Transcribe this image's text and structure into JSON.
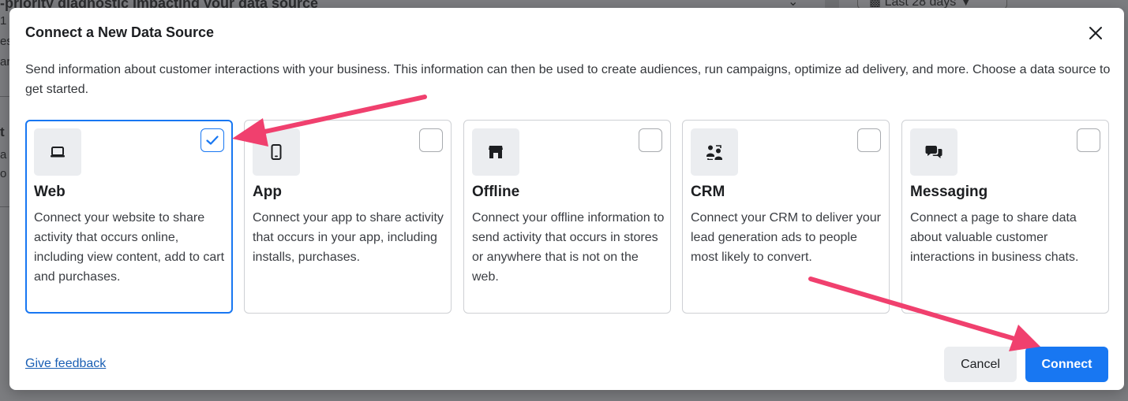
{
  "background": {
    "top_text": "-priority diagnostic impacting your data source",
    "date_range": "Last 28 days",
    "left_fragments": [
      "1",
      "es",
      "ar",
      "t",
      "a",
      "o"
    ]
  },
  "modal": {
    "title": "Connect a New Data Source",
    "description": "Send information about customer interactions with your business. This information can then be used to create audiences, run campaigns, optimize ad delivery, and more. Choose a data source to get started.",
    "cards": [
      {
        "title": "Web",
        "description": "Connect your website to share activity that occurs online, including view content, add to cart and purchases.",
        "icon": "laptop-icon",
        "selected": true
      },
      {
        "title": "App",
        "description": "Connect your app to share activity that occurs in your app, including installs, purchases.",
        "icon": "mobile-phone-icon",
        "selected": false
      },
      {
        "title": "Offline",
        "description": "Connect your offline information to send activity that occurs in stores or anywhere that is not on the web.",
        "icon": "store-icon",
        "selected": false
      },
      {
        "title": "CRM",
        "description": "Connect your CRM to deliver your lead generation ads to people most likely to convert.",
        "icon": "people-swap-icon",
        "selected": false
      },
      {
        "title": "Messaging",
        "description": "Connect a page to share data about valuable customer interactions in business chats.",
        "icon": "chat-bubbles-icon",
        "selected": false
      }
    ],
    "feedback_label": "Give feedback",
    "cancel_label": "Cancel",
    "connect_label": "Connect"
  },
  "colors": {
    "accent": "#1877f2",
    "annotation_arrow": "#f0406e"
  }
}
